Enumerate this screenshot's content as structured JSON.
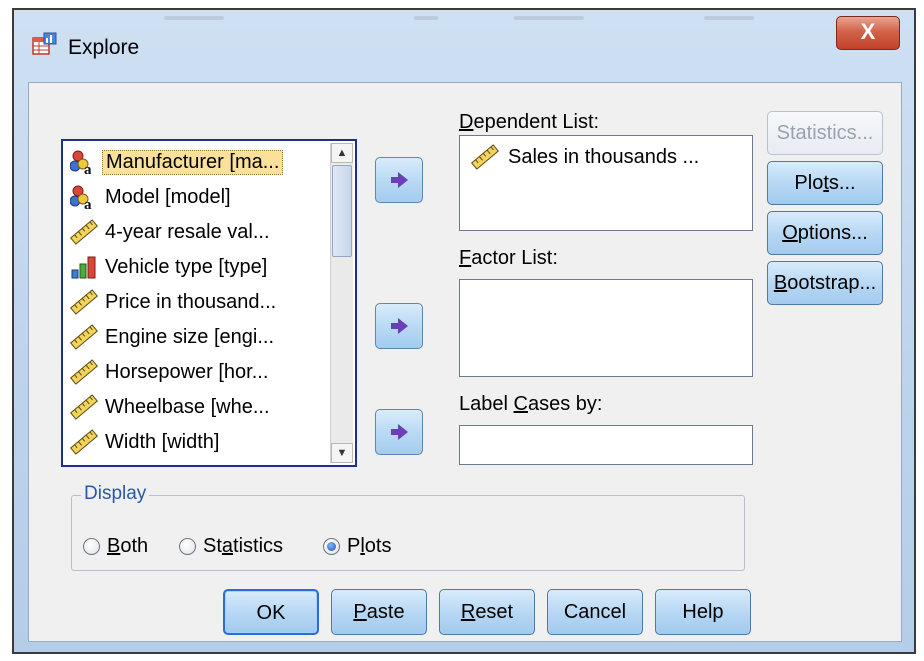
{
  "window": {
    "title": "Explore",
    "close_label": "X"
  },
  "variables": [
    {
      "label": "Manufacturer [ma...",
      "icon": "nominal-string-icon",
      "selected": true
    },
    {
      "label": "Model [model]",
      "icon": "nominal-string-icon"
    },
    {
      "label": "4-year resale val...",
      "icon": "scale-ruler-icon"
    },
    {
      "label": "Vehicle type [type]",
      "icon": "nominal-bar-icon"
    },
    {
      "label": "Price in thousand...",
      "icon": "scale-ruler-icon"
    },
    {
      "label": "Engine size [engi...",
      "icon": "scale-ruler-icon"
    },
    {
      "label": "Horsepower [hor...",
      "icon": "scale-ruler-icon"
    },
    {
      "label": "Wheelbase [whe...",
      "icon": "scale-ruler-icon"
    },
    {
      "label": "Width [width]",
      "icon": "scale-ruler-icon"
    }
  ],
  "dependent_list": {
    "label_pre": "",
    "label_key": "D",
    "label_post": "ependent List:",
    "items": [
      "Sales in thousands ..."
    ]
  },
  "factor_list": {
    "label_pre": "",
    "label_key": "F",
    "label_post": "actor List:"
  },
  "label_cases": {
    "label_pre": "Label ",
    "label_key": "C",
    "label_post": "ases by:",
    "value": ""
  },
  "side_buttons": {
    "statistics": "Statistics...",
    "plots_pre": "Plo",
    "plots_key": "t",
    "plots_post": "s...",
    "options_pre": "",
    "options_key": "O",
    "options_post": "ptions...",
    "bootstrap_pre": "",
    "bootstrap_key": "B",
    "bootstrap_post": "ootstrap..."
  },
  "display": {
    "legend": "Display",
    "both_key": "B",
    "both_post": "oth",
    "statistics_pre": "St",
    "statistics_key": "a",
    "statistics_post": "tistics",
    "plots_pre": "P",
    "plots_key": "l",
    "plots_post": "ots",
    "selected": "plots"
  },
  "buttons": {
    "ok": "OK",
    "paste_key": "P",
    "paste_post": "aste",
    "reset_key": "R",
    "reset_post": "eset",
    "cancel": "Cancel",
    "help": "Help"
  },
  "colors": {
    "accent": "#2d6bd6",
    "legend": "#2a58a8",
    "selection": "#fbe09a",
    "close": "#c2412a"
  }
}
